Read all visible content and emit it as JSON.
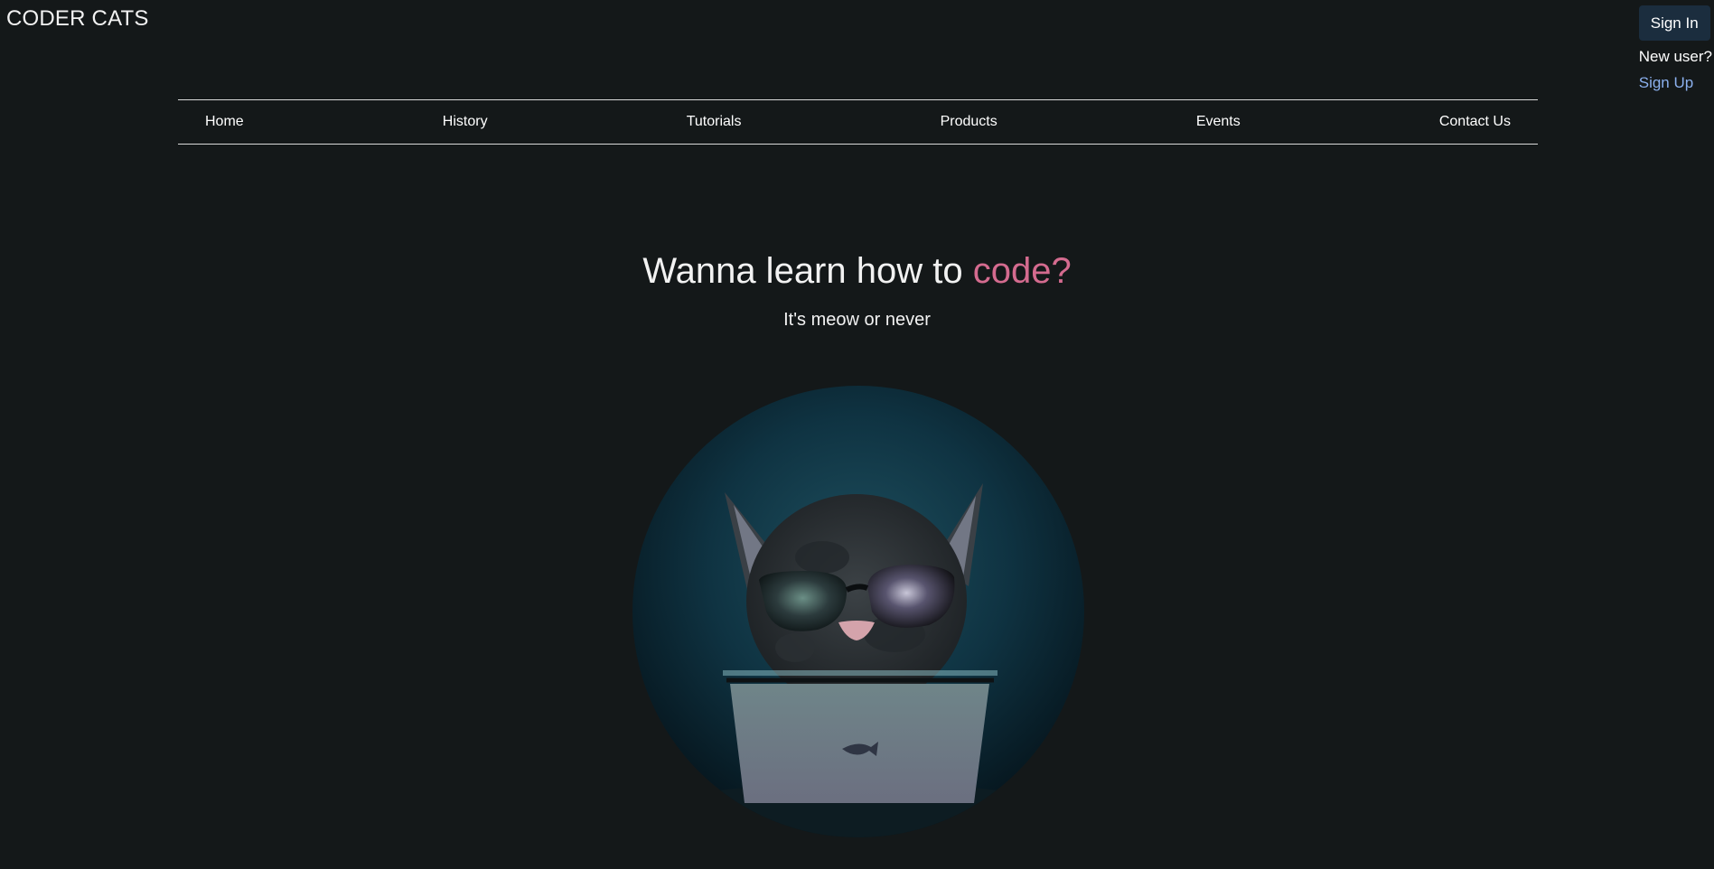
{
  "brand": {
    "logo_text": "CODER CATS"
  },
  "auth": {
    "signin_label": "Sign In",
    "new_user_text": "New user?",
    "signup_label": "Sign Up"
  },
  "nav": {
    "items": [
      {
        "label": "Home"
      },
      {
        "label": "History"
      },
      {
        "label": "Tutorials"
      },
      {
        "label": "Products"
      },
      {
        "label": "Events"
      },
      {
        "label": "Contact Us"
      }
    ]
  },
  "hero": {
    "title_prefix": "Wanna learn how to ",
    "title_accent": "code?",
    "subtitle": "It's meow or never"
  },
  "colors": {
    "background": "#141819",
    "accent": "#d46b8f",
    "link": "#8bb0ee",
    "button_bg": "#1b2d3e"
  }
}
